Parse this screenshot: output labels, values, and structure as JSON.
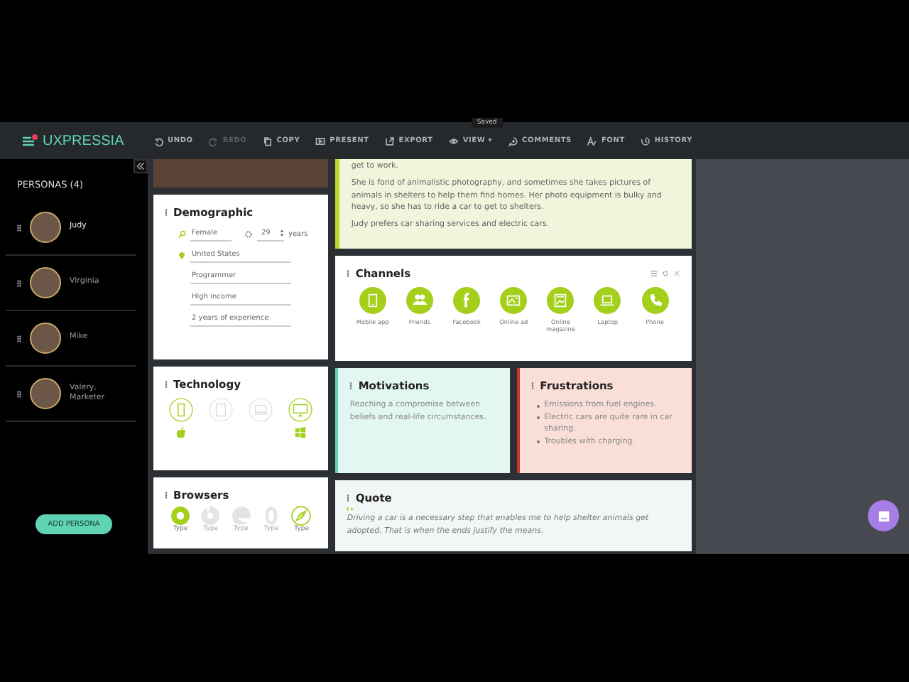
{
  "toolbar": {
    "logo": "UXPRESSIA",
    "saved_tooltip": "Saved",
    "actions": [
      {
        "kind": "undo",
        "label": "UNDO",
        "disabled": false
      },
      {
        "kind": "redo",
        "label": "REDO",
        "disabled": true
      },
      {
        "kind": "copy",
        "label": "COPY",
        "disabled": false
      },
      {
        "kind": "present",
        "label": "PRESENT",
        "disabled": false
      },
      {
        "kind": "export",
        "label": "EXPORT",
        "disabled": false
      },
      {
        "kind": "view",
        "label": "VIEW ▾",
        "disabled": false
      },
      {
        "kind": "comments",
        "label": "COMMENTS",
        "disabled": false
      },
      {
        "kind": "font",
        "label": "FONT",
        "disabled": false
      },
      {
        "kind": "history",
        "label": "HISTORY",
        "disabled": false
      }
    ]
  },
  "sidebar": {
    "title": "PERSONAS (4)",
    "add_button": "ADD PERSONA",
    "personas": [
      {
        "name": "Judy",
        "selected": true
      },
      {
        "name": "Virginia",
        "selected": false
      },
      {
        "name": "Mike",
        "selected": false
      },
      {
        "name": "Valery, Marketer",
        "selected": false
      }
    ]
  },
  "story": {
    "paragraphs": [
      "get to work.",
      "She is fond of animalistic photography, and sometimes she takes pictures of animals in shelters to help them find homes. Her photo equipment is bulky and heavy, so she has to ride a car to get to shelters.",
      "Judy prefers car sharing services and electric cars."
    ]
  },
  "demographic": {
    "title": "Demographic",
    "gender": "Female",
    "age": "29",
    "age_unit": "years",
    "location": "United States",
    "fields": [
      "Programmer",
      "High income",
      "2 years of experience"
    ]
  },
  "channels": {
    "title": "Channels",
    "items": [
      {
        "kind": "mobile",
        "label": "Mobile app"
      },
      {
        "kind": "friends",
        "label": "Friends"
      },
      {
        "kind": "facebook",
        "label": "Facebook"
      },
      {
        "kind": "ad",
        "label": "Online ad"
      },
      {
        "kind": "magazine",
        "label": "Online magazine"
      },
      {
        "kind": "laptop",
        "label": "Laptop"
      },
      {
        "kind": "phone",
        "label": "Phone"
      }
    ]
  },
  "technology": {
    "title": "Technology",
    "devices": [
      {
        "kind": "phone",
        "selected": true
      },
      {
        "kind": "tablet",
        "selected": false
      },
      {
        "kind": "laptop",
        "selected": false
      },
      {
        "kind": "desktop",
        "selected": true
      }
    ],
    "os": [
      {
        "kind": "apple"
      },
      {
        "kind": "none"
      },
      {
        "kind": "none"
      },
      {
        "kind": "windows"
      }
    ]
  },
  "motivations": {
    "title": "Motivations",
    "text": "Reaching a compromise between beliefs and real-life circumstances."
  },
  "frustrations": {
    "title": "Frustrations",
    "items": [
      "Emissions from fuel engines.",
      "Electric cars are quite rare in car sharing.",
      "Troubles with charging."
    ]
  },
  "browsers": {
    "title": "Browsers",
    "items": [
      {
        "kind": "chrome",
        "label": "Type",
        "selected": true
      },
      {
        "kind": "firefox",
        "label": "Type",
        "selected": false
      },
      {
        "kind": "edge",
        "label": "Type",
        "selected": false
      },
      {
        "kind": "opera",
        "label": "Type",
        "selected": false
      },
      {
        "kind": "safari",
        "label": "Type",
        "selected": true
      }
    ]
  },
  "quote": {
    "title": "Quote",
    "text": "Driving a car is a necessary step that enables me to help shelter animals get adopted. That is when the ends justify the means."
  }
}
